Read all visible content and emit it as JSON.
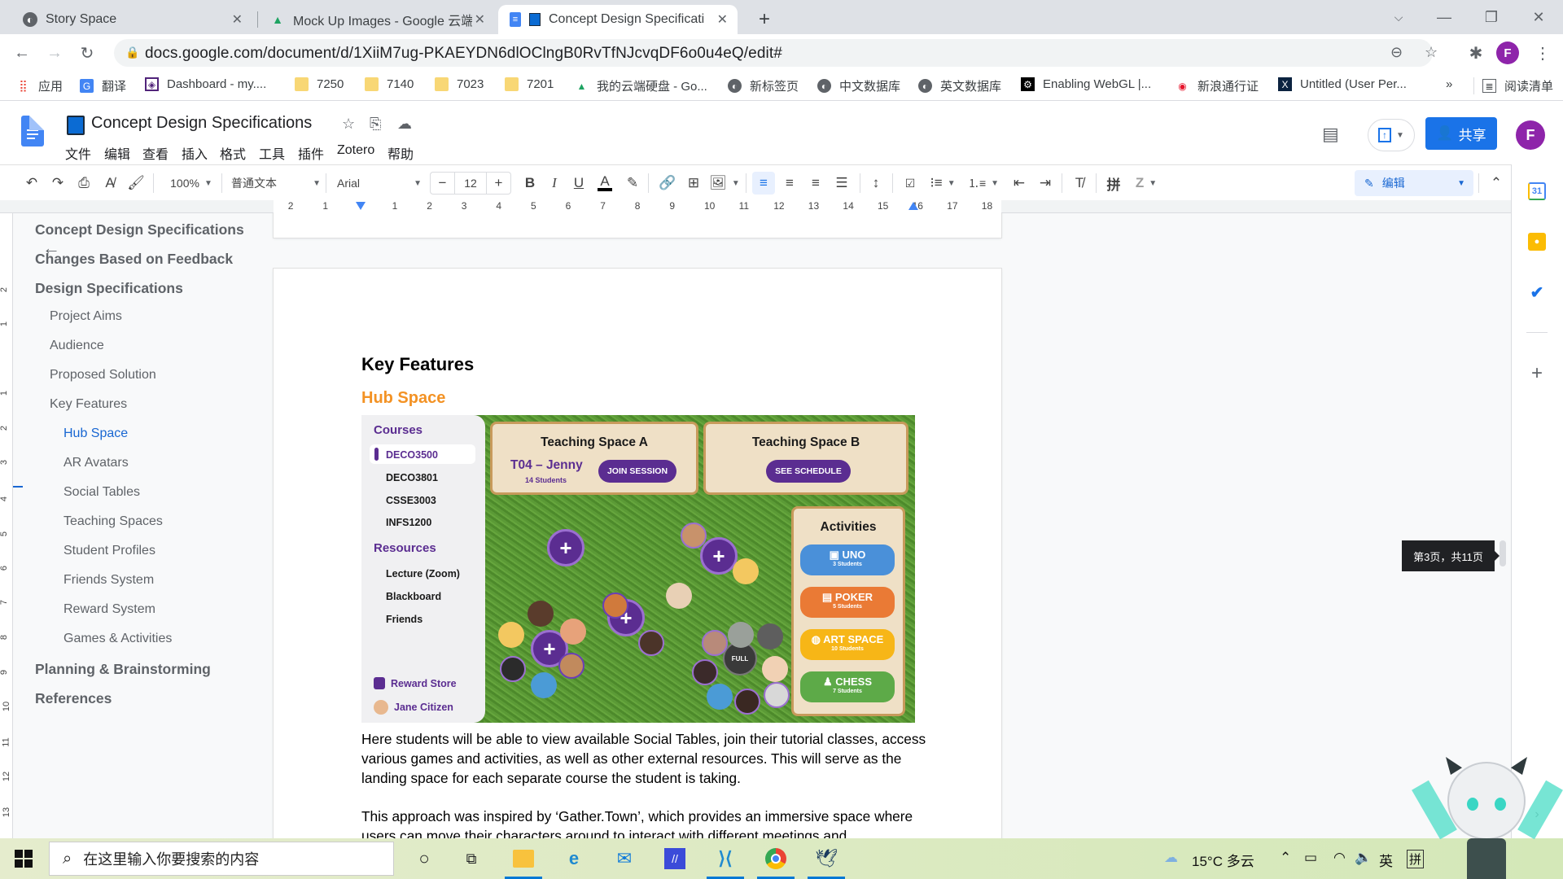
{
  "browser": {
    "tabs": [
      {
        "title": "Story Space",
        "icon": "globe-icon",
        "active": false
      },
      {
        "title": "Mock Up Images - Google 云端硬盘",
        "icon": "google-drive-icon",
        "active": false
      },
      {
        "title": "Concept Design Specificati",
        "icon": "google-docs-icon",
        "active": true
      }
    ],
    "new_tab_label": "+",
    "url": "docs.google.com/document/d/1XiiM7ug-PKAEYDN6dlOClngB0RvTfNJcvqDF6o0u4eQ/edit#",
    "profile_initial": "F",
    "bookmarks": [
      {
        "label": "应用",
        "icon": "apps-grid-icon"
      },
      {
        "label": "翻译",
        "icon": "google-translate-icon"
      },
      {
        "label": "Dashboard - my....",
        "icon": "dashboard-icon"
      },
      {
        "label": "7250",
        "icon": "folder-icon"
      },
      {
        "label": "7140",
        "icon": "folder-icon"
      },
      {
        "label": "7023",
        "icon": "folder-icon"
      },
      {
        "label": "7201",
        "icon": "folder-icon"
      },
      {
        "label": "我的云端硬盘 - Go...",
        "icon": "google-drive-icon"
      },
      {
        "label": "新标签页",
        "icon": "globe-icon"
      },
      {
        "label": "中文数据库",
        "icon": "globe-icon"
      },
      {
        "label": "英文数据库",
        "icon": "globe-icon"
      },
      {
        "label": "Enabling WebGL |...",
        "icon": "webgl-icon"
      },
      {
        "label": "新浪通行证",
        "icon": "weibo-icon"
      },
      {
        "label": "Untitled (User Per...",
        "icon": "x-logo-icon"
      }
    ],
    "bookmarks_overflow": "»",
    "reading_list": "阅读清单"
  },
  "docs": {
    "title": "Concept Design Specifications",
    "menus": [
      "文件",
      "编辑",
      "查看",
      "插入",
      "格式",
      "工具",
      "插件",
      "Zotero",
      "帮助"
    ],
    "share_label": "共享",
    "account_initial": "F",
    "toolbar": {
      "zoom": "100%",
      "style": "普通文本",
      "font": "Arial",
      "font_size": "12",
      "mode": "编辑",
      "pinyin": "拼"
    },
    "ruler_numbers": [
      "2",
      "1",
      "",
      "1",
      "2",
      "3",
      "4",
      "5",
      "6",
      "7",
      "8",
      "9",
      "10",
      "11",
      "12",
      "13",
      "14",
      "15",
      "16",
      "17",
      "18"
    ],
    "vruler_numbers": [
      "2",
      "1",
      "1",
      "2",
      "3",
      "4",
      "5",
      "6",
      "7",
      "8",
      "9",
      "10",
      "11",
      "12",
      "13"
    ],
    "page_indicator": "第3页，共11页",
    "outline": [
      {
        "label": "Concept Design Specifications",
        "level": 1
      },
      {
        "label": "Changes Based on Feedback",
        "level": 1
      },
      {
        "label": "Design Specifications",
        "level": 1
      },
      {
        "label": "Project Aims",
        "level": 2
      },
      {
        "label": "Audience",
        "level": 2
      },
      {
        "label": "Proposed Solution",
        "level": 2
      },
      {
        "label": "Key Features",
        "level": 2
      },
      {
        "label": "Hub Space",
        "level": 3,
        "active": true
      },
      {
        "label": "AR Avatars",
        "level": 3
      },
      {
        "label": "Social Tables",
        "level": 3
      },
      {
        "label": "Teaching Spaces",
        "level": 3
      },
      {
        "label": "Student Profiles",
        "level": 3
      },
      {
        "label": "Friends System",
        "level": 3
      },
      {
        "label": "Reward System",
        "level": 3
      },
      {
        "label": "Games & Activities",
        "level": 3
      },
      {
        "label": "Planning & Brainstorming",
        "level": 1
      },
      {
        "label": "References",
        "level": 1
      }
    ],
    "content": {
      "heading": "Key Features",
      "subheading": "Hub Space",
      "paragraph1": "Here students will be able to view available Social Tables, join their tutorial classes, access various games and activities, as well as other external resources. This will serve as the landing space for each separate course the student is taking.",
      "paragraph2": "This approach was inspired by ‘Gather.Town’, which provides an immersive space where users can move their characters around to interact with different meetings and"
    },
    "mockup": {
      "courses_heading": "Courses",
      "courses": [
        "DECO3500",
        "DECO3801",
        "CSSE3003",
        "INFS1200"
      ],
      "selected_course": "DECO3500",
      "resources_heading": "Resources",
      "resources": [
        "Lecture (Zoom)",
        "Blackboard",
        "Friends"
      ],
      "reward_store": "Reward Store",
      "user_name": "Jane Citizen",
      "teaching_a": {
        "title": "Teaching Space A",
        "session": "T04 – Jenny",
        "students": "14 Students",
        "button": "JOIN SESSION"
      },
      "teaching_b": {
        "title": "Teaching Space B",
        "button": "SEE SCHEDULE"
      },
      "activities_heading": "Activities",
      "activities": [
        {
          "name": "UNO",
          "students": "3 Students",
          "color": "#4a90d9"
        },
        {
          "name": "POKER",
          "students": "5 Students",
          "color": "#ea7a35"
        },
        {
          "name": "ART SPACE",
          "students": "10 Students",
          "color": "#f7b617"
        },
        {
          "name": "CHESS",
          "students": "7 Students",
          "color": "#5daa48"
        }
      ],
      "full_label": "FULL",
      "join_label": "+"
    }
  },
  "taskbar": {
    "search_placeholder": "在这里输入你要搜索的内容",
    "weather": "15°C 多云",
    "ime_lang": "英",
    "ime_mode": "拼"
  }
}
